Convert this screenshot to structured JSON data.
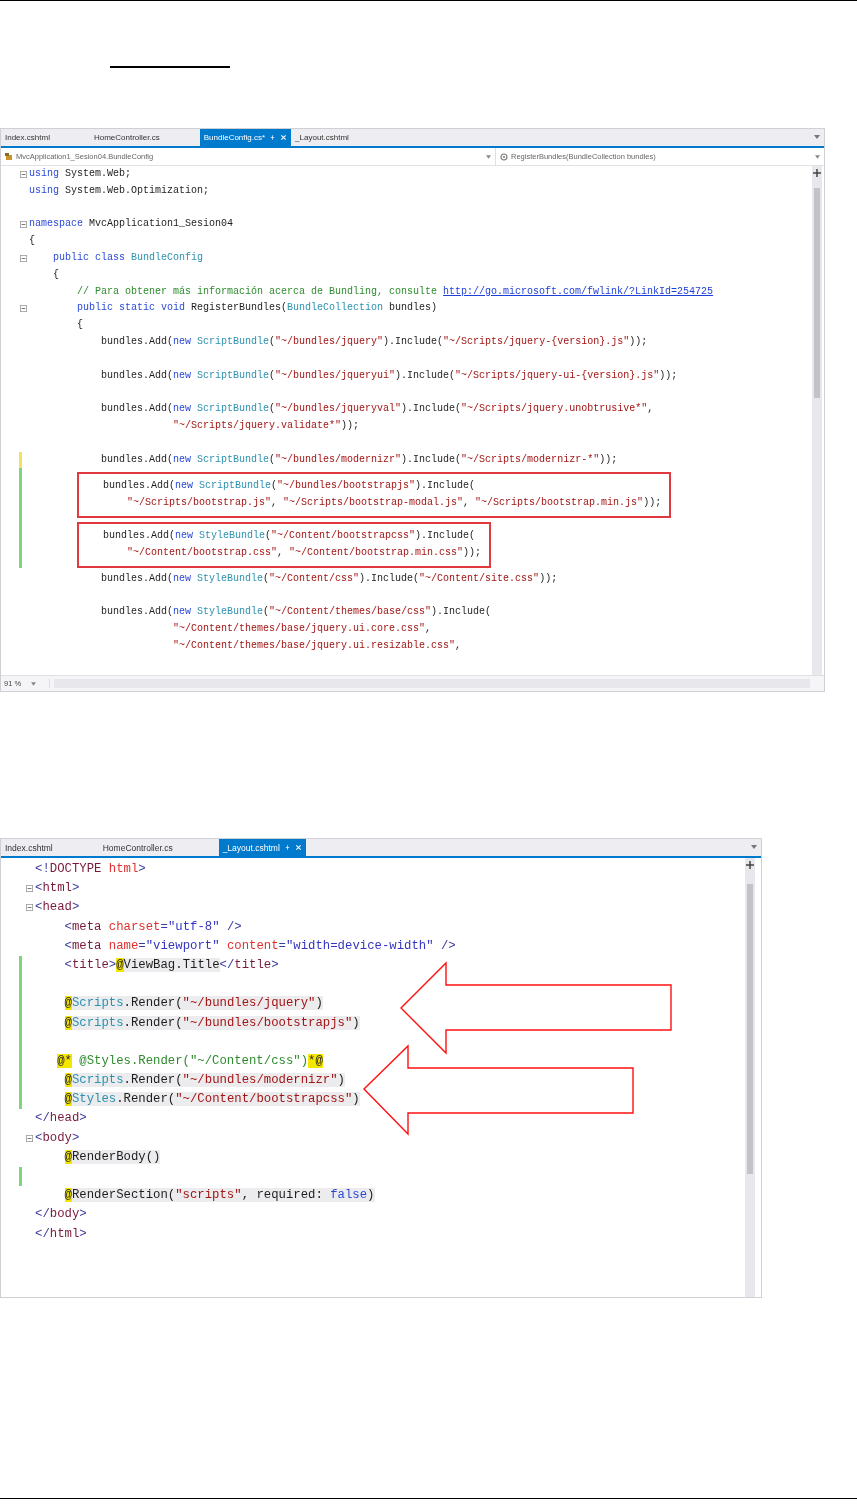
{
  "editors": [
    {
      "tabs": [
        {
          "label": "Index.cshtml",
          "selected": false
        },
        {
          "label": "HomeController.cs",
          "selected": false
        },
        {
          "label": "BundleConfig.cs*",
          "selected": true
        },
        {
          "label": "_Layout.cshtml",
          "selected": false
        }
      ],
      "navigation": {
        "type": "MvcApplication1_Sesion04.BundleConfig",
        "member": "RegisterBundles(BundleCollection bundles)"
      },
      "lines": [
        {
          "kind": "line",
          "fold": true,
          "tokens": [
            {
              "text": "using",
              "kind": "kw"
            },
            {
              "text": " System.Web;",
              "kind": "plain"
            }
          ]
        },
        {
          "kind": "line",
          "fold": false,
          "tokens": [
            {
              "text": "using",
              "kind": "kw"
            },
            {
              "text": " System.Web.Optimization;",
              "kind": "plain"
            }
          ]
        },
        {
          "kind": "blank"
        },
        {
          "kind": "line",
          "fold": true,
          "tokens": [
            {
              "text": "namespace",
              "kind": "kw"
            },
            {
              "text": " MvcApplication1_Sesion04",
              "kind": "plain"
            }
          ]
        },
        {
          "kind": "line",
          "fold": false,
          "tokens": [
            {
              "text": "{",
              "kind": "plain"
            }
          ]
        },
        {
          "kind": "line",
          "fold": true,
          "tokens": [
            {
              "text": "    public class",
              "kind": "kw"
            },
            {
              "text": " BundleConfig",
              "kind": "type"
            }
          ]
        },
        {
          "kind": "line",
          "fold": false,
          "tokens": [
            {
              "text": "    {",
              "kind": "plain"
            }
          ]
        },
        {
          "kind": "line",
          "fold": false,
          "tokens": [
            {
              "text": "        // Para obtener más información acerca de Bundling, consulte ",
              "kind": "comment"
            },
            {
              "text": "http://go.microsoft.com/fwlink/?LinkId=254725",
              "kind": "link"
            }
          ]
        },
        {
          "kind": "line",
          "fold": true,
          "tokens": [
            {
              "text": "        public static void",
              "kind": "kw"
            },
            {
              "text": " RegisterBundles(",
              "kind": "plain"
            },
            {
              "text": "BundleCollection",
              "kind": "type"
            },
            {
              "text": " bundles)",
              "kind": "plain"
            }
          ]
        },
        {
          "kind": "line",
          "fold": false,
          "tokens": [
            {
              "text": "        {",
              "kind": "plain"
            }
          ]
        },
        {
          "kind": "line",
          "fold": false,
          "tokens": [
            {
              "text": "            bundles.Add(",
              "kind": "plain"
            },
            {
              "text": "new",
              "kind": "kw"
            },
            {
              "text": " ScriptBundle",
              "kind": "type"
            },
            {
              "text": "(",
              "kind": "plain"
            },
            {
              "text": "\"~/bundles/jquery\"",
              "kind": "str"
            },
            {
              "text": ").Include(",
              "kind": "plain"
            },
            {
              "text": "\"~/Scripts/jquery-{version}.js\"",
              "kind": "str"
            },
            {
              "text": "));",
              "kind": "plain"
            }
          ]
        },
        {
          "kind": "blank"
        },
        {
          "kind": "line",
          "fold": false,
          "tokens": [
            {
              "text": "            bundles.Add(",
              "kind": "plain"
            },
            {
              "text": "new",
              "kind": "kw"
            },
            {
              "text": " ScriptBundle",
              "kind": "type"
            },
            {
              "text": "(",
              "kind": "plain"
            },
            {
              "text": "\"~/bundles/jqueryui\"",
              "kind": "str"
            },
            {
              "text": ").Include(",
              "kind": "plain"
            },
            {
              "text": "\"~/Scripts/jquery-ui-{version}.js\"",
              "kind": "str"
            },
            {
              "text": "));",
              "kind": "plain"
            }
          ]
        },
        {
          "kind": "blank"
        },
        {
          "kind": "line",
          "fold": false,
          "tokens": [
            {
              "text": "            bundles.Add(",
              "kind": "plain"
            },
            {
              "text": "new",
              "kind": "kw"
            },
            {
              "text": " ScriptBundle",
              "kind": "type"
            },
            {
              "text": "(",
              "kind": "plain"
            },
            {
              "text": "\"~/bundles/jqueryval\"",
              "kind": "str"
            },
            {
              "text": ").Include(",
              "kind": "plain"
            },
            {
              "text": "\"~/Scripts/jquery.unobtrusive*\"",
              "kind": "str"
            },
            {
              "text": ",",
              "kind": "plain"
            }
          ]
        },
        {
          "kind": "line",
          "fold": false,
          "tokens": [
            {
              "text": "                        \"~/Scripts/jquery.validate*\"",
              "kind": "str"
            },
            {
              "text": "));",
              "kind": "plain"
            }
          ]
        },
        {
          "kind": "blank"
        },
        {
          "kind": "line",
          "fold": false,
          "color": "#f2e35a",
          "tokens": [
            {
              "text": "            bundles.Add(",
              "kind": "plain"
            },
            {
              "text": "new",
              "kind": "kw"
            },
            {
              "text": " ScriptBundle",
              "kind": "type"
            },
            {
              "text": "(",
              "kind": "plain"
            },
            {
              "text": "\"~/bundles/modernizr\"",
              "kind": "str"
            },
            {
              "text": ").Include(",
              "kind": "plain"
            },
            {
              "text": "\"~/Scripts/modernizr-*\"",
              "kind": "str"
            },
            {
              "text": "));",
              "kind": "plain"
            }
          ]
        },
        {
          "kind": "box",
          "color": "#7dd67d",
          "lines": [
            {
              "fold": false,
              "tokens": [
                {
                  "text": "            bundles.Add(",
                  "kind": "plain"
                },
                {
                  "text": "new",
                  "kind": "kw"
                },
                {
                  "text": " ScriptBundle",
                  "kind": "type"
                },
                {
                  "text": "(",
                  "kind": "plain"
                },
                {
                  "text": "\"~/bundles/bootstrapjs\"",
                  "kind": "str"
                },
                {
                  "text": ").Include(",
                  "kind": "plain"
                }
              ]
            },
            {
              "fold": false,
              "tokens": [
                {
                  "text": "                \"~/Scripts/bootstrap.js\"",
                  "kind": "str"
                },
                {
                  "text": ", ",
                  "kind": "plain"
                },
                {
                  "text": "\"~/Scripts/bootstrap-modal.js\"",
                  "kind": "str"
                },
                {
                  "text": ", ",
                  "kind": "plain"
                },
                {
                  "text": "\"~/Scripts/bootstrap.min.js\"",
                  "kind": "str"
                },
                {
                  "text": "));",
                  "kind": "plain"
                }
              ]
            }
          ]
        },
        {
          "kind": "box",
          "color": "#7dd67d",
          "lines": [
            {
              "fold": false,
              "tokens": [
                {
                  "text": "            bundles.Add(",
                  "kind": "plain"
                },
                {
                  "text": "new",
                  "kind": "kw"
                },
                {
                  "text": " StyleBundle",
                  "kind": "type"
                },
                {
                  "text": "(",
                  "kind": "plain"
                },
                {
                  "text": "\"~/Content/bootstrapcss\"",
                  "kind": "str"
                },
                {
                  "text": ").Include(",
                  "kind": "plain"
                }
              ]
            },
            {
              "fold": false,
              "tokens": [
                {
                  "text": "                \"~/Content/bootstrap.css\"",
                  "kind": "str"
                },
                {
                  "text": ", ",
                  "kind": "plain"
                },
                {
                  "text": "\"~/Content/bootstrap.min.css\"",
                  "kind": "str"
                },
                {
                  "text": "));",
                  "kind": "plain"
                }
              ]
            }
          ]
        },
        {
          "kind": "line",
          "fold": false,
          "tokens": [
            {
              "text": "            bundles.Add(",
              "kind": "plain"
            },
            {
              "text": "new",
              "kind": "kw"
            },
            {
              "text": " StyleBundle",
              "kind": "type"
            },
            {
              "text": "(",
              "kind": "plain"
            },
            {
              "text": "\"~/Content/css\"",
              "kind": "str"
            },
            {
              "text": ").Include(",
              "kind": "plain"
            },
            {
              "text": "\"~/Content/site.css\"",
              "kind": "str"
            },
            {
              "text": "));",
              "kind": "plain"
            }
          ]
        },
        {
          "kind": "blank"
        },
        {
          "kind": "line",
          "fold": false,
          "tokens": [
            {
              "text": "            bundles.Add(",
              "kind": "plain"
            },
            {
              "text": "new",
              "kind": "kw"
            },
            {
              "text": " StyleBundle",
              "kind": "type"
            },
            {
              "text": "(",
              "kind": "plain"
            },
            {
              "text": "\"~/Content/themes/base/css\"",
              "kind": "str"
            },
            {
              "text": ").Include(",
              "kind": "plain"
            }
          ]
        },
        {
          "kind": "line",
          "fold": false,
          "tokens": [
            {
              "text": "                        \"~/Content/themes/base/jquery.ui.core.css\"",
              "kind": "str"
            },
            {
              "text": ",",
              "kind": "plain"
            }
          ]
        },
        {
          "kind": "line",
          "fold": false,
          "tokens": [
            {
              "text": "                        \"~/Content/themes/base/jquery.ui.resizable.css\"",
              "kind": "str"
            },
            {
              "text": ",",
              "kind": "plain"
            }
          ]
        }
      ],
      "zoom": "91 %"
    },
    {
      "tabs": [
        {
          "label": "Index.cshtml",
          "selected": false
        },
        {
          "label": "HomeController.cs",
          "selected": false
        },
        {
          "label": "_Layout.cshtml",
          "selected": true
        }
      ],
      "lines": [
        {
          "kind": "line",
          "fold": false,
          "tokens": [
            {
              "text": "<!",
              "kind": "delim"
            },
            {
              "text": "DOCTYPE",
              "kind": "el"
            },
            {
              "text": " html",
              "kind": "attr"
            },
            {
              "text": ">",
              "kind": "delim"
            }
          ]
        },
        {
          "kind": "line",
          "fold": true,
          "tokens": [
            {
              "text": "<",
              "kind": "delim"
            },
            {
              "text": "html",
              "kind": "el"
            },
            {
              "text": ">",
              "kind": "delim"
            }
          ]
        },
        {
          "kind": "line",
          "fold": true,
          "tokens": [
            {
              "text": "<",
              "kind": "delim"
            },
            {
              "text": "head",
              "kind": "el"
            },
            {
              "text": ">",
              "kind": "delim"
            }
          ]
        },
        {
          "kind": "line",
          "fold": false,
          "tokens": [
            {
              "text": "    <",
              "kind": "delim"
            },
            {
              "text": "meta",
              "kind": "el"
            },
            {
              "text": " charset",
              "kind": "attr"
            },
            {
              "text": "=",
              "kind": "delim"
            },
            {
              "text": "\"utf-8\"",
              "kind": "val"
            },
            {
              "text": " />",
              "kind": "delim"
            }
          ]
        },
        {
          "kind": "line",
          "fold": false,
          "tokens": [
            {
              "text": "    <",
              "kind": "delim"
            },
            {
              "text": "meta",
              "kind": "el"
            },
            {
              "text": " name",
              "kind": "attr"
            },
            {
              "text": "=",
              "kind": "delim"
            },
            {
              "text": "\"viewport\"",
              "kind": "val"
            },
            {
              "text": " content",
              "kind": "attr"
            },
            {
              "text": "=",
              "kind": "delim"
            },
            {
              "text": "\"width=device-width\"",
              "kind": "val"
            },
            {
              "text": " />",
              "kind": "delim"
            }
          ]
        },
        {
          "kind": "line",
          "fold": false,
          "color": "#7dd67d",
          "tokens": [
            {
              "text": "    <",
              "kind": "delim"
            },
            {
              "text": "title",
              "kind": "el"
            },
            {
              "text": ">",
              "kind": "delim"
            },
            {
              "text": "@",
              "kind": "at"
            },
            {
              "text": "ViewBag.Title",
              "kind": "rz-plain"
            },
            {
              "text": "</",
              "kind": "delim"
            },
            {
              "text": "title",
              "kind": "el"
            },
            {
              "text": ">",
              "kind": "delim"
            }
          ]
        },
        {
          "kind": "blank",
          "color": "#7dd67d"
        },
        {
          "kind": "line",
          "fold": false,
          "color": "#7dd67d",
          "tokens": [
            {
              "text": "    @",
              "kind": "at"
            },
            {
              "text": "Scripts",
              "kind": "rz-type"
            },
            {
              "text": ".Render(",
              "kind": "rz-plain"
            },
            {
              "text": "\"~/bundles/jquery\"",
              "kind": "rz-str"
            },
            {
              "text": ")",
              "kind": "rz-plain"
            }
          ]
        },
        {
          "kind": "line",
          "fold": false,
          "color": "#7dd67d",
          "tokens": [
            {
              "text": "    @",
              "kind": "at"
            },
            {
              "text": "Scripts",
              "kind": "rz-type"
            },
            {
              "text": ".Render(",
              "kind": "rz-plain"
            },
            {
              "text": "\"~/bundles/bootstrapjs\"",
              "kind": "rz-str"
            },
            {
              "text": ")",
              "kind": "rz-plain"
            }
          ]
        },
        {
          "kind": "blank",
          "color": "#7dd67d"
        },
        {
          "kind": "line",
          "fold": false,
          "color": "#7dd67d",
          "tokens": [
            {
              "text": "   @*",
              "kind": "at"
            },
            {
              "text": " @Styles.Render(\"~/Content/css\")",
              "kind": "comment"
            },
            {
              "text": "*@",
              "kind": "at"
            }
          ]
        },
        {
          "kind": "line",
          "fold": false,
          "color": "#7dd67d",
          "tokens": [
            {
              "text": "    @",
              "kind": "at"
            },
            {
              "text": "Scripts",
              "kind": "rz-type"
            },
            {
              "text": ".Render(",
              "kind": "rz-plain"
            },
            {
              "text": "\"~/bundles/modernizr\"",
              "kind": "rz-str"
            },
            {
              "text": ")",
              "kind": "rz-plain"
            }
          ]
        },
        {
          "kind": "line",
          "fold": false,
          "color": "#7dd67d",
          "tokens": [
            {
              "text": "    @",
              "kind": "at"
            },
            {
              "text": "Styles",
              "kind": "rz-type"
            },
            {
              "text": ".Render(",
              "kind": "rz-plain"
            },
            {
              "text": "\"~/Content/bootstrapcss\"",
              "kind": "rz-str"
            },
            {
              "text": ")",
              "kind": "rz-plain"
            }
          ]
        },
        {
          "kind": "line",
          "fold": false,
          "tokens": [
            {
              "text": "</",
              "kind": "delim"
            },
            {
              "text": "head",
              "kind": "el"
            },
            {
              "text": ">",
              "kind": "delim"
            }
          ]
        },
        {
          "kind": "line",
          "fold": true,
          "tokens": [
            {
              "text": "<",
              "kind": "delim"
            },
            {
              "text": "body",
              "kind": "el"
            },
            {
              "text": ">",
              "kind": "delim"
            }
          ]
        },
        {
          "kind": "line",
          "fold": false,
          "tokens": [
            {
              "text": "    @",
              "kind": "at"
            },
            {
              "text": "RenderBody()",
              "kind": "rz-plain"
            }
          ]
        },
        {
          "kind": "blank",
          "color": "#7dd67d"
        },
        {
          "kind": "line",
          "fold": false,
          "tokens": [
            {
              "text": "    @",
              "kind": "at"
            },
            {
              "text": "RenderSection(",
              "kind": "rz-plain"
            },
            {
              "text": "\"scripts\"",
              "kind": "rz-str"
            },
            {
              "text": ", required: ",
              "kind": "rz-plain"
            },
            {
              "text": "false",
              "kind": "rz-kw"
            },
            {
              "text": ")",
              "kind": "rz-plain"
            }
          ]
        },
        {
          "kind": "line",
          "fold": false,
          "tokens": [
            {
              "text": "</",
              "kind": "delim"
            },
            {
              "text": "body",
              "kind": "el"
            },
            {
              "text": ">",
              "kind": "delim"
            }
          ]
        },
        {
          "kind": "line",
          "fold": false,
          "tokens": [
            {
              "text": "</",
              "kind": "delim"
            },
            {
              "text": "html",
              "kind": "el"
            },
            {
              "text": ">",
              "kind": "delim"
            }
          ]
        }
      ],
      "annotations": [
        {
          "kind": "arrow"
        },
        {
          "kind": "arrow"
        }
      ]
    }
  ]
}
